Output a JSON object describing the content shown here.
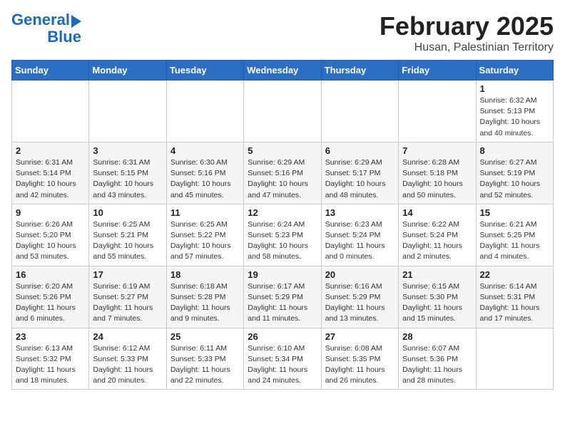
{
  "logo": {
    "line1": "General",
    "line2": "Blue"
  },
  "title": "February 2025",
  "subtitle": "Husan, Palestinian Territory",
  "days_of_week": [
    "Sunday",
    "Monday",
    "Tuesday",
    "Wednesday",
    "Thursday",
    "Friday",
    "Saturday"
  ],
  "weeks": [
    [
      {
        "day": "",
        "info": ""
      },
      {
        "day": "",
        "info": ""
      },
      {
        "day": "",
        "info": ""
      },
      {
        "day": "",
        "info": ""
      },
      {
        "day": "",
        "info": ""
      },
      {
        "day": "",
        "info": ""
      },
      {
        "day": "1",
        "info": "Sunrise: 6:32 AM\nSunset: 5:13 PM\nDaylight: 10 hours\nand 40 minutes."
      }
    ],
    [
      {
        "day": "2",
        "info": "Sunrise: 6:31 AM\nSunset: 5:14 PM\nDaylight: 10 hours\nand 42 minutes."
      },
      {
        "day": "3",
        "info": "Sunrise: 6:31 AM\nSunset: 5:15 PM\nDaylight: 10 hours\nand 43 minutes."
      },
      {
        "day": "4",
        "info": "Sunrise: 6:30 AM\nSunset: 5:16 PM\nDaylight: 10 hours\nand 45 minutes."
      },
      {
        "day": "5",
        "info": "Sunrise: 6:29 AM\nSunset: 5:16 PM\nDaylight: 10 hours\nand 47 minutes."
      },
      {
        "day": "6",
        "info": "Sunrise: 6:29 AM\nSunset: 5:17 PM\nDaylight: 10 hours\nand 48 minutes."
      },
      {
        "day": "7",
        "info": "Sunrise: 6:28 AM\nSunset: 5:18 PM\nDaylight: 10 hours\nand 50 minutes."
      },
      {
        "day": "8",
        "info": "Sunrise: 6:27 AM\nSunset: 5:19 PM\nDaylight: 10 hours\nand 52 minutes."
      }
    ],
    [
      {
        "day": "9",
        "info": "Sunrise: 6:26 AM\nSunset: 5:20 PM\nDaylight: 10 hours\nand 53 minutes."
      },
      {
        "day": "10",
        "info": "Sunrise: 6:25 AM\nSunset: 5:21 PM\nDaylight: 10 hours\nand 55 minutes."
      },
      {
        "day": "11",
        "info": "Sunrise: 6:25 AM\nSunset: 5:22 PM\nDaylight: 10 hours\nand 57 minutes."
      },
      {
        "day": "12",
        "info": "Sunrise: 6:24 AM\nSunset: 5:23 PM\nDaylight: 10 hours\nand 58 minutes."
      },
      {
        "day": "13",
        "info": "Sunrise: 6:23 AM\nSunset: 5:24 PM\nDaylight: 11 hours\nand 0 minutes."
      },
      {
        "day": "14",
        "info": "Sunrise: 6:22 AM\nSunset: 5:24 PM\nDaylight: 11 hours\nand 2 minutes."
      },
      {
        "day": "15",
        "info": "Sunrise: 6:21 AM\nSunset: 5:25 PM\nDaylight: 11 hours\nand 4 minutes."
      }
    ],
    [
      {
        "day": "16",
        "info": "Sunrise: 6:20 AM\nSunset: 5:26 PM\nDaylight: 11 hours\nand 6 minutes."
      },
      {
        "day": "17",
        "info": "Sunrise: 6:19 AM\nSunset: 5:27 PM\nDaylight: 11 hours\nand 7 minutes."
      },
      {
        "day": "18",
        "info": "Sunrise: 6:18 AM\nSunset: 5:28 PM\nDaylight: 11 hours\nand 9 minutes."
      },
      {
        "day": "19",
        "info": "Sunrise: 6:17 AM\nSunset: 5:29 PM\nDaylight: 11 hours\nand 11 minutes."
      },
      {
        "day": "20",
        "info": "Sunrise: 6:16 AM\nSunset: 5:29 PM\nDaylight: 11 hours\nand 13 minutes."
      },
      {
        "day": "21",
        "info": "Sunrise: 6:15 AM\nSunset: 5:30 PM\nDaylight: 11 hours\nand 15 minutes."
      },
      {
        "day": "22",
        "info": "Sunrise: 6:14 AM\nSunset: 5:31 PM\nDaylight: 11 hours\nand 17 minutes."
      }
    ],
    [
      {
        "day": "23",
        "info": "Sunrise: 6:13 AM\nSunset: 5:32 PM\nDaylight: 11 hours\nand 18 minutes."
      },
      {
        "day": "24",
        "info": "Sunrise: 6:12 AM\nSunset: 5:33 PM\nDaylight: 11 hours\nand 20 minutes."
      },
      {
        "day": "25",
        "info": "Sunrise: 6:11 AM\nSunset: 5:33 PM\nDaylight: 11 hours\nand 22 minutes."
      },
      {
        "day": "26",
        "info": "Sunrise: 6:10 AM\nSunset: 5:34 PM\nDaylight: 11 hours\nand 24 minutes."
      },
      {
        "day": "27",
        "info": "Sunrise: 6:08 AM\nSunset: 5:35 PM\nDaylight: 11 hours\nand 26 minutes."
      },
      {
        "day": "28",
        "info": "Sunrise: 6:07 AM\nSunset: 5:36 PM\nDaylight: 11 hours\nand 28 minutes."
      },
      {
        "day": "",
        "info": ""
      }
    ]
  ]
}
